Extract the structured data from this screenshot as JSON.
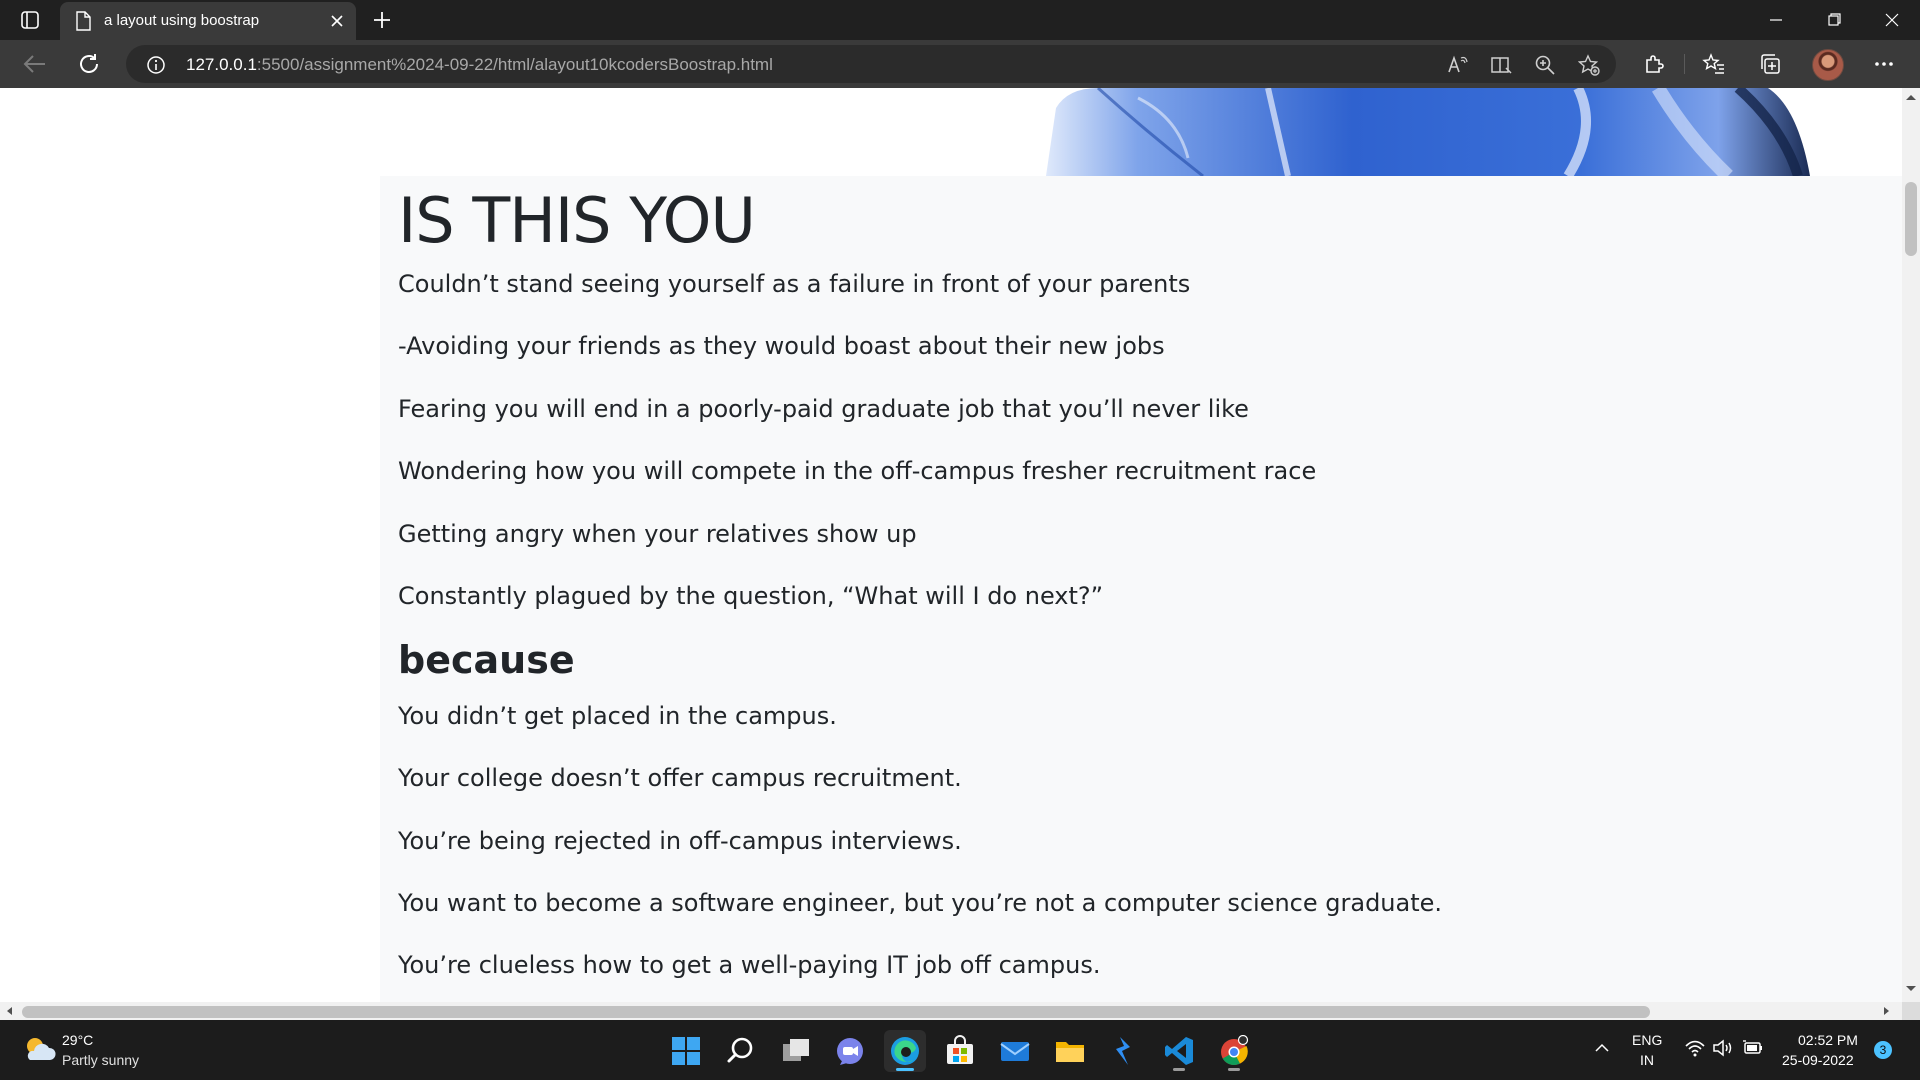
{
  "browser": {
    "tab_title": "a layout using boostrap",
    "url_host": "127.0.0.1",
    "url_path": ":5500/assignment%2024-09-22/html/alayout10kcodersBoostrap.html"
  },
  "page": {
    "heading": "IS THIS YOU",
    "paragraphs": [
      "Couldn’t stand seeing yourself as a failure in front of your parents",
      "-Avoiding your friends as they would boast about their new jobs",
      "Fearing you will end in a poorly-paid graduate job that you’ll never like",
      "Wondering how you will compete in the off-campus fresher recruitment race",
      "Getting angry when your relatives show up",
      "Constantly plagued by the question, “What will I do next?”"
    ],
    "subheading": "because",
    "reasons": [
      "You didn’t get placed in the campus.",
      "Your college doesn’t offer campus recruitment.",
      "You’re being rejected in off-campus interviews.",
      "You want to become a software engineer, but you’re not a computer science graduate.",
      "You’re clueless how to get a well-paying IT job off campus."
    ]
  },
  "taskbar": {
    "weather_temp": "29°C",
    "weather_desc": "Partly sunny",
    "lang_top": "ENG",
    "lang_bottom": "IN",
    "time": "02:52 PM",
    "date": "25-09-2022",
    "notification_count": "3"
  },
  "colors": {
    "content_background": "#f8f9fa",
    "text": "#212529",
    "accent": "#4cc2ff"
  }
}
